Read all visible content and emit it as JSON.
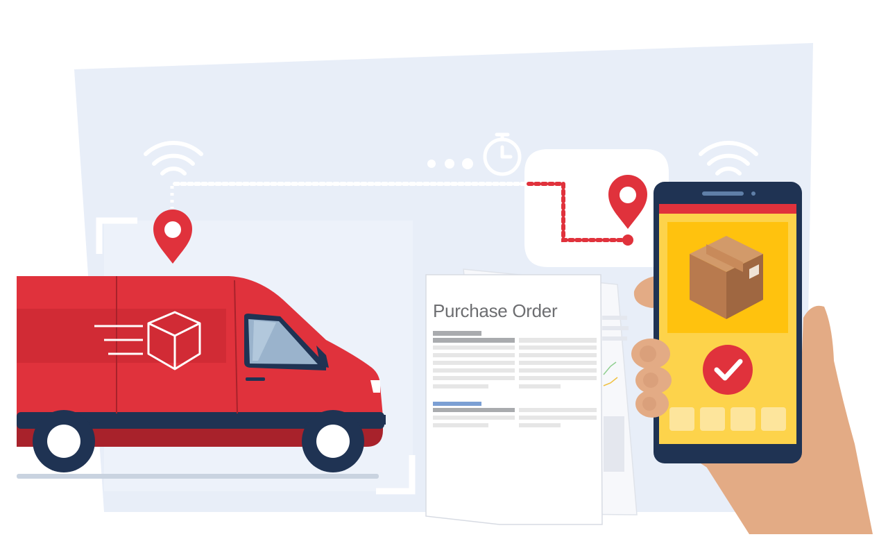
{
  "illustration": {
    "document": {
      "title": "Purchase Order"
    },
    "colors": {
      "background_panel": "#e8eef8",
      "van_red": "#e0323c",
      "van_dark_red": "#a8222b",
      "navy": "#1f3353",
      "pin_red": "#e0323c",
      "phone_screen_yellow": "#fdd34b",
      "phone_panel_yellow": "#ffc20e",
      "box_brown": "#b87a4e",
      "hand_skin": "#e3ab85",
      "wifi_white": "#ffffff",
      "dots_white": "#ffffff"
    },
    "icons": [
      "wifi-signal-icon",
      "location-pin-icon",
      "stopwatch-icon",
      "package-icon",
      "checkmark-icon",
      "cube-icon"
    ],
    "phone": {
      "status": "delivered",
      "bottom_tiles": 4
    }
  }
}
